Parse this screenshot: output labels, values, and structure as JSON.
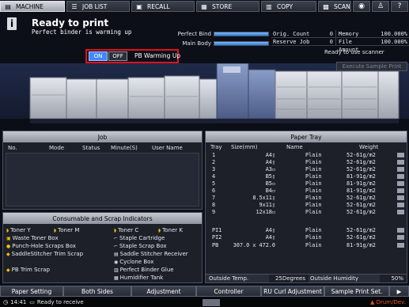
{
  "tabs": [
    {
      "label": "MACHINE",
      "icon": "machine-icon",
      "active": true
    },
    {
      "label": "JOB LIST",
      "icon": "list-icon",
      "active": false
    },
    {
      "label": "RECALL",
      "icon": "recall-icon",
      "active": false
    },
    {
      "label": "STORE",
      "icon": "store-icon",
      "active": false
    },
    {
      "label": "COPY",
      "icon": "copy-icon",
      "active": false
    },
    {
      "label": "SCAN",
      "icon": "scan-icon",
      "active": false
    }
  ],
  "header": {
    "title": "Ready to print",
    "subtitle": "Perfect binder is warming up"
  },
  "gauges": {
    "perfect_bind_label": "Perfect Bind",
    "perfect_bind_level": 1.0,
    "main_body_label": "Main Body",
    "main_body_level": 1.0
  },
  "stats": {
    "orig_count_label": "Orig. Count",
    "orig_count_value": "0",
    "memory_label": "Memory",
    "memory_value": "100.000%",
    "reserve_job_label": "Reserve Job",
    "reserve_job_value": "0",
    "file_amount_label": "File Amount",
    "file_amount_value": "100.000%"
  },
  "warming": {
    "on_label": "ON",
    "off_label": "OFF",
    "label": "PB Warming Up",
    "highlight_color": "#e1101a"
  },
  "scanner_status": "Ready to use scanner",
  "execute_sample": "Execute Sample Print",
  "job_panel": {
    "title": "Job",
    "columns": [
      "No.",
      "Mode",
      "Status",
      "Minute(S)",
      "User Name"
    ]
  },
  "paper_tray": {
    "title": "Paper Tray",
    "columns": [
      "Tray",
      "Size(mm)",
      "Name",
      "Weight"
    ],
    "rows": [
      {
        "tray": "1",
        "size": "A4▯",
        "name": "Plain",
        "weight": "52-61g/m2"
      },
      {
        "tray": "2",
        "size": "A4▯",
        "name": "Plain",
        "weight": "52-61g/m2"
      },
      {
        "tray": "3",
        "size": "A3▭",
        "name": "Plain",
        "weight": "52-61g/m2"
      },
      {
        "tray": "4",
        "size": "B5▯",
        "name": "Plain",
        "weight": "81-91g/m2"
      },
      {
        "tray": "5",
        "size": "B5▭",
        "name": "Plain",
        "weight": "81-91g/m2"
      },
      {
        "tray": "6",
        "size": "B4▭",
        "name": "Plain",
        "weight": "81-91g/m2"
      },
      {
        "tray": "7",
        "size": "8.5x11▯",
        "name": "Plain",
        "weight": "52-61g/m2"
      },
      {
        "tray": "8",
        "size": "9x11▯",
        "name": "Plain",
        "weight": "52-61g/m2"
      },
      {
        "tray": "9",
        "size": "12x18▭",
        "name": "Plain",
        "weight": "52-61g/m2"
      }
    ],
    "extra_rows": [
      {
        "tray": "PI1",
        "size": "A4▯",
        "name": "Plain",
        "weight": "52-61g/m2"
      },
      {
        "tray": "PI2",
        "size": "A4▯",
        "name": "Plain",
        "weight": "52-61g/m2"
      },
      {
        "tray": "PB",
        "size": "307.0 x 472.0",
        "name": "Plain",
        "weight": "81-91g/m2"
      }
    ],
    "outside_temp_label": "Outside Temp.",
    "outside_temp_value": "25Degrees",
    "outside_humidity_label": "Outside Humidity",
    "outside_humidity_value": "50%"
  },
  "consumables": {
    "title": "Consumable and Scrap Indicators",
    "items": [
      {
        "label": "Toner Y",
        "icon": "toner-icon"
      },
      {
        "label": "Toner M",
        "icon": "toner-icon"
      },
      {
        "label": "Toner C",
        "icon": "toner-icon"
      },
      {
        "label": "Toner K",
        "icon": "toner-icon"
      },
      {
        "label": "Waste Toner Box",
        "icon": "waste-toner-icon"
      },
      {
        "label": "Staple Cartridge",
        "icon": "staple-icon"
      },
      {
        "label": "Punch-Hole Scraps Box",
        "icon": "punch-icon"
      },
      {
        "label": "Staple Scrap Box",
        "icon": "staple-scrap-icon"
      },
      {
        "label": "SaddleStitcher Trim Scrap",
        "icon": "trim-icon"
      },
      {
        "label": "Saddle Stitcher Receiver",
        "icon": "receiver-icon"
      },
      {
        "label": "Cyclone Box",
        "icon": "cyclone-icon"
      },
      {
        "label": "PB Trim Scrap",
        "icon": "trim-icon"
      },
      {
        "label": "Perfect Binder Glue",
        "icon": "glue-icon"
      },
      {
        "label": "Humidifier Tank",
        "icon": "tank-icon"
      }
    ]
  },
  "bottom_buttons": [
    "Paper Setting",
    "Both Sides",
    "Adjustment",
    "Controller",
    "RU Curl Adjustment",
    "Sample Print Set."
  ],
  "status_bar": {
    "time": "14:41",
    "message": "Ready to receive",
    "drum_label": "Drum/Dev."
  }
}
